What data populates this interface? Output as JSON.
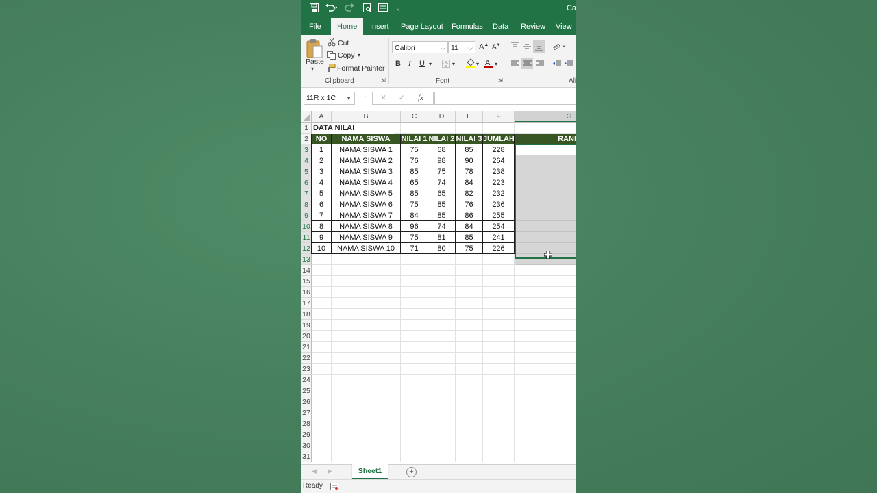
{
  "title_bar": {
    "title_fragment": "Ca"
  },
  "ribbon_tabs": [
    {
      "label": "File",
      "active": false
    },
    {
      "label": "Home",
      "active": true
    },
    {
      "label": "Insert",
      "active": false
    },
    {
      "label": "Page Layout",
      "active": false
    },
    {
      "label": "Formulas",
      "active": false
    },
    {
      "label": "Data",
      "active": false
    },
    {
      "label": "Review",
      "active": false
    },
    {
      "label": "View",
      "active": false
    }
  ],
  "clipboard": {
    "paste_label": "Paste",
    "cut_label": "Cut",
    "copy_label": "Copy",
    "format_painter_label": "Format Painter",
    "group_label": "Clipboard"
  },
  "font_group": {
    "font_name": "Calibri",
    "font_size": "11",
    "bold": "B",
    "italic": "I",
    "underline": "U",
    "group_label": "Font",
    "font_color": "#c00000",
    "fill_color": "#ffff00"
  },
  "alignment_group": {
    "group_label_fragment": "Ali"
  },
  "formula_bar": {
    "name_box": "11R x 1C",
    "cancel_symbol": "✕",
    "enter_symbol": "✓",
    "fx_label": "fx",
    "formula": ""
  },
  "columns": [
    "A",
    "B",
    "C",
    "D",
    "E",
    "F",
    "G"
  ],
  "selected_column": "G",
  "row_numbers": [
    "1",
    "2",
    "3",
    "4",
    "5",
    "6",
    "7",
    "8",
    "9",
    "10",
    "11",
    "12",
    "13",
    "14",
    "15",
    "16",
    "17",
    "18",
    "19",
    "20",
    "21",
    "22",
    "23",
    "24",
    "25",
    "26",
    "27",
    "28",
    "29",
    "30",
    "31"
  ],
  "sheet": {
    "title": "DATA NILAI",
    "headers": [
      "NO",
      "NAMA SISWA",
      "NILAI 1",
      "NILAI 2",
      "NILAI 3",
      "JUMLAH",
      "RANI"
    ],
    "rows": [
      [
        "1",
        "NAMA SISWA 1",
        "75",
        "68",
        "85",
        "228"
      ],
      [
        "2",
        "NAMA SISWA 2",
        "76",
        "98",
        "90",
        "264"
      ],
      [
        "3",
        "NAMA SISWA 3",
        "85",
        "75",
        "78",
        "238"
      ],
      [
        "4",
        "NAMA SISWA 4",
        "65",
        "74",
        "84",
        "223"
      ],
      [
        "5",
        "NAMA SISWA 5",
        "85",
        "65",
        "82",
        "232"
      ],
      [
        "6",
        "NAMA SISWA 6",
        "75",
        "85",
        "76",
        "236"
      ],
      [
        "7",
        "NAMA SISWA 7",
        "84",
        "85",
        "86",
        "255"
      ],
      [
        "8",
        "NAMA SISWA 8",
        "96",
        "74",
        "84",
        "254"
      ],
      [
        "9",
        "NAMA SISWA 9",
        "75",
        "81",
        "85",
        "241"
      ],
      [
        "10",
        "NAMA SISWA 10",
        "71",
        "80",
        "75",
        "226"
      ]
    ],
    "header_fill": "#375623"
  },
  "sheet_tabs": {
    "active": "Sheet1",
    "add_symbol": "+"
  },
  "status_bar": {
    "status": "Ready"
  },
  "colors": {
    "accent": "#217346",
    "background": "#4a8360"
  }
}
